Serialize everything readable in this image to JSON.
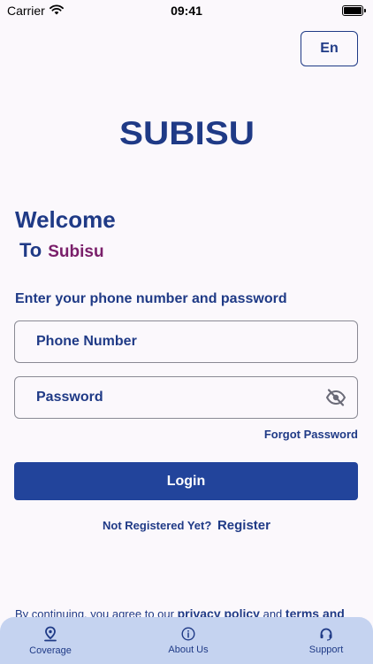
{
  "status_bar": {
    "carrier": "Carrier",
    "time": "09:41"
  },
  "header": {
    "language_label": "En"
  },
  "brand": {
    "logo_text": "SUBISU",
    "primary_color": "#1f3a86",
    "accent_color": "#7a1f6a"
  },
  "welcome": {
    "title": "Welcome",
    "to": "To",
    "brand_name": "Subisu"
  },
  "form": {
    "instruction": "Enter your phone number and password",
    "phone_placeholder": "Phone Number",
    "password_placeholder": "Password",
    "password_toggle_icon": "eye-off-icon",
    "forgot_password": "Forgot Password",
    "login_label": "Login",
    "not_registered": "Not Registered Yet?",
    "register_link": "Register"
  },
  "terms": {
    "prefix": "By continuing, you agree to our",
    "privacy_link": "privacy policy",
    "and": "and",
    "terms_link": "terms and"
  },
  "bottom_nav": {
    "items": [
      {
        "label": "Coverage",
        "icon": "location-pin-icon"
      },
      {
        "label": "About Us",
        "icon": "info-icon"
      },
      {
        "label": "Support",
        "icon": "headset-icon"
      }
    ]
  }
}
